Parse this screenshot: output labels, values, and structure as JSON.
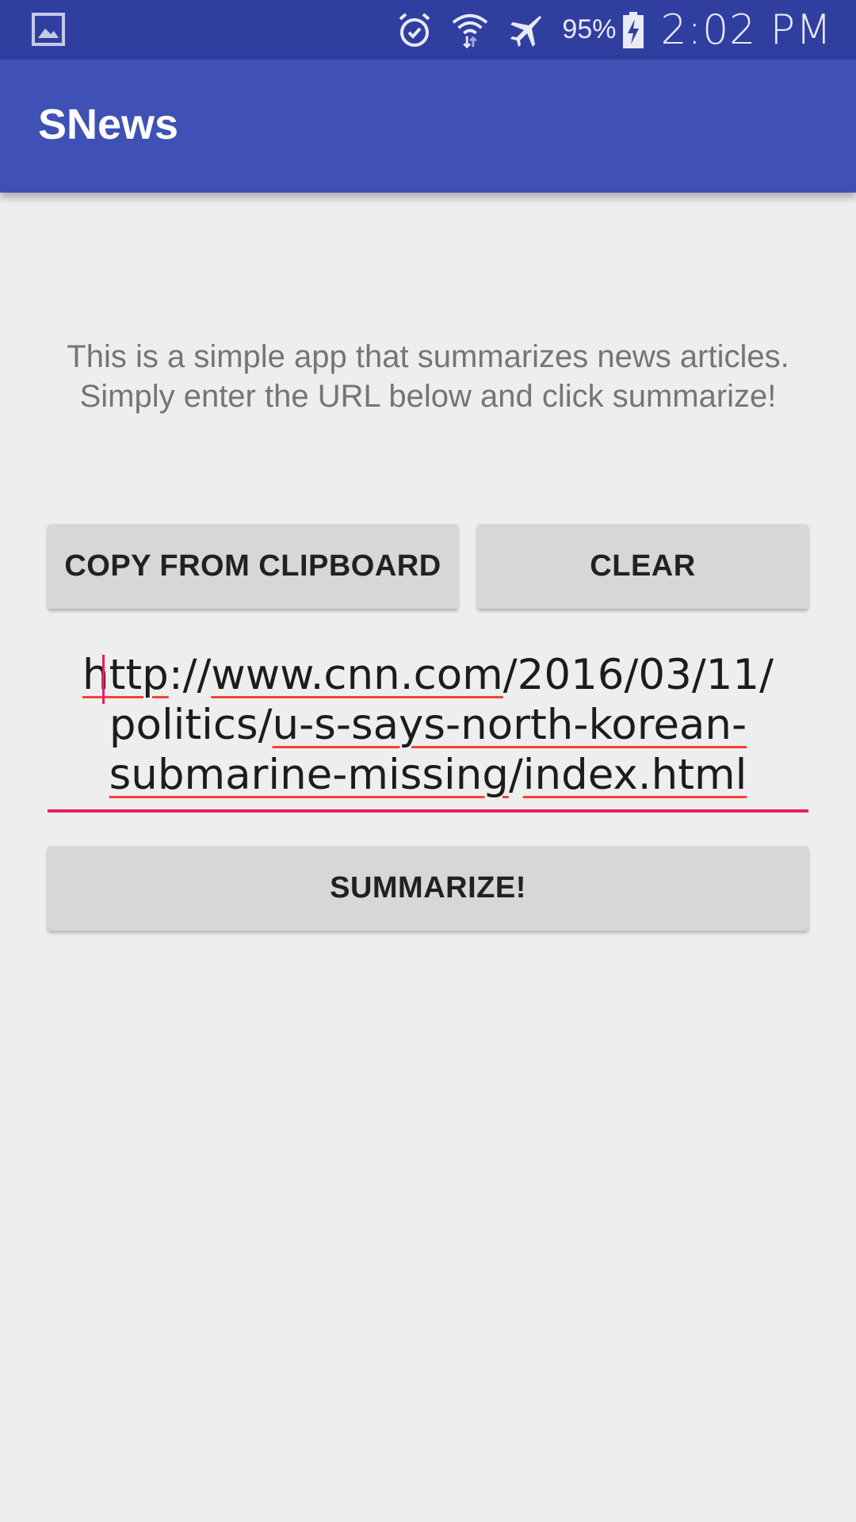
{
  "status_bar": {
    "left_icon": "image-icon",
    "icons": [
      "alarm-icon",
      "wifi-icon",
      "airplane-mode-icon"
    ],
    "battery_percent": "95%",
    "battery_icon": "battery-charging-icon",
    "time": "2:02 PM"
  },
  "app_bar": {
    "title": "SNews",
    "color": "#3f51b5"
  },
  "intro": {
    "line1": "This is a simple app that summarizes news articles.",
    "line2": "Simply enter the URL below and click summarize!"
  },
  "buttons": {
    "copy_label": "COPY FROM CLIPBOARD",
    "clear_label": "CLEAR",
    "summarize_label": "SUMMARIZE!"
  },
  "url_input": {
    "segments": [
      "http",
      "://",
      "www.cnn.com",
      "/2016/03/11/",
      "politics/",
      "u-s-says-north-korean-",
      "submarine-missing",
      "/",
      "index.html"
    ],
    "accent_color": "#e91e63"
  }
}
